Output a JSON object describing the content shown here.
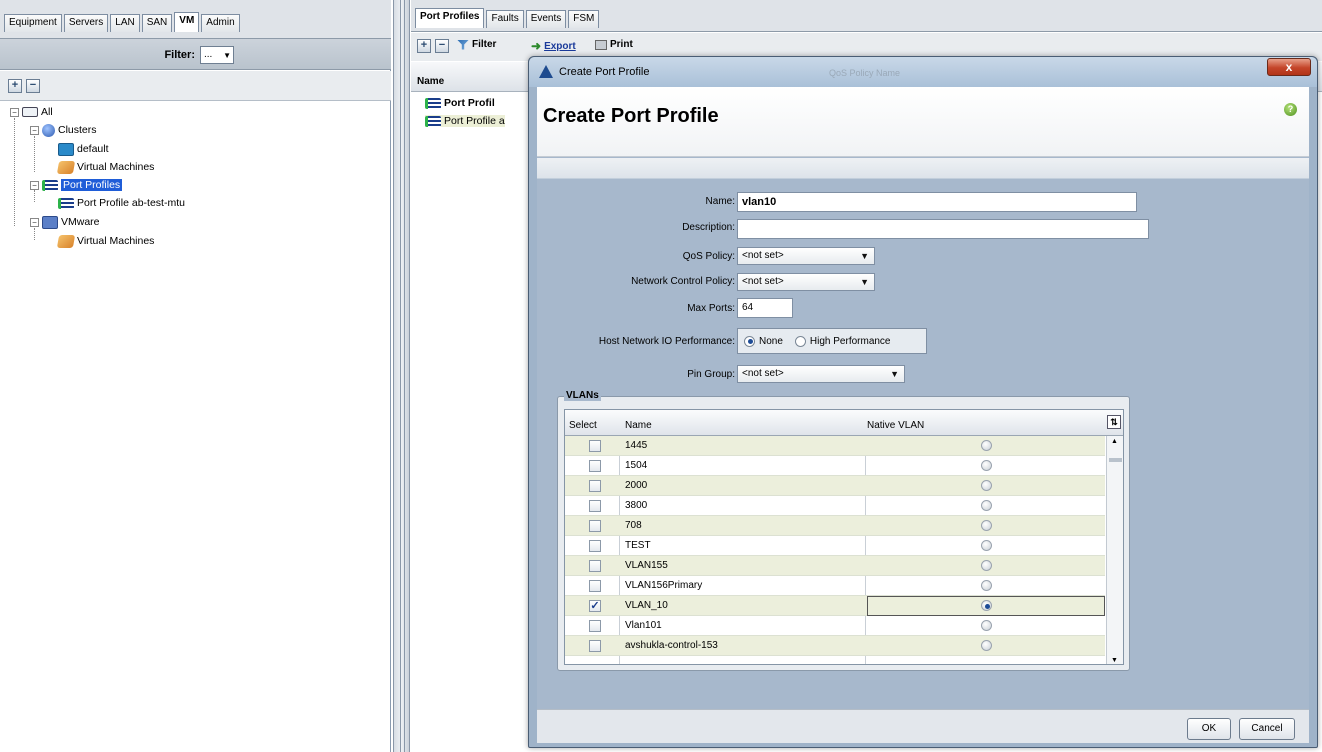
{
  "nav": {
    "tabs": [
      "Equipment",
      "Servers",
      "LAN",
      "SAN",
      "VM",
      "Admin"
    ],
    "active_tab": "VM",
    "filter_label": "Filter:",
    "filter_value": "..."
  },
  "tree": {
    "all": "All",
    "clusters": "Clusters",
    "default": "default",
    "cluster_vms": "Virtual Machines",
    "port_profiles": "Port Profiles",
    "port_profile_item": "Port Profile ab-test-mtu",
    "vmware": "VMware",
    "vmware_vms": "Virtual Machines"
  },
  "right": {
    "tabs": [
      "Port Profiles",
      "Faults",
      "Events",
      "FSM"
    ],
    "toolbar": {
      "filter": "Filter",
      "export": "Export",
      "print": "Print"
    },
    "column_name": "Name",
    "rows": [
      "Port Profil",
      "Port Profile a"
    ],
    "ghost_header": "QoS Policy Name"
  },
  "dialog": {
    "window_title": "Create Port Profile",
    "ghost_title": "QoS Policy Name",
    "close_label": "x",
    "heading": "Create Port Profile",
    "help": "?",
    "fields": {
      "name_label": "Name:",
      "name_value": "vlan10",
      "description_label": "Description:",
      "description_value": "",
      "qos_label": "QoS Policy:",
      "qos_value": "<not set>",
      "ncp_label": "Network Control Policy:",
      "ncp_value": "<not set>",
      "maxports_label": "Max Ports:",
      "maxports_value": "64",
      "hostio_label": "Host Network IO Performance:",
      "hostio_none": "None",
      "hostio_high": "High Performance",
      "pingroup_label": "Pin Group:",
      "pingroup_value": "<not set>"
    },
    "vlans": {
      "legend": "VLANs",
      "col_select": "Select",
      "col_name": "Name",
      "col_native": "Native VLAN",
      "rows": [
        {
          "name": "1445",
          "selected": false,
          "native": false
        },
        {
          "name": "1504",
          "selected": false,
          "native": false
        },
        {
          "name": "2000",
          "selected": false,
          "native": false
        },
        {
          "name": "3800",
          "selected": false,
          "native": false
        },
        {
          "name": "708",
          "selected": false,
          "native": false
        },
        {
          "name": "TEST",
          "selected": false,
          "native": false
        },
        {
          "name": "VLAN155",
          "selected": false,
          "native": false
        },
        {
          "name": "VLAN156Primary",
          "selected": false,
          "native": false
        },
        {
          "name": "VLAN_10",
          "selected": true,
          "native": true
        },
        {
          "name": "Vlan101",
          "selected": false,
          "native": false
        },
        {
          "name": "avshukla-control-153",
          "selected": false,
          "native": false
        }
      ]
    },
    "buttons": {
      "ok": "OK",
      "cancel": "Cancel"
    }
  }
}
